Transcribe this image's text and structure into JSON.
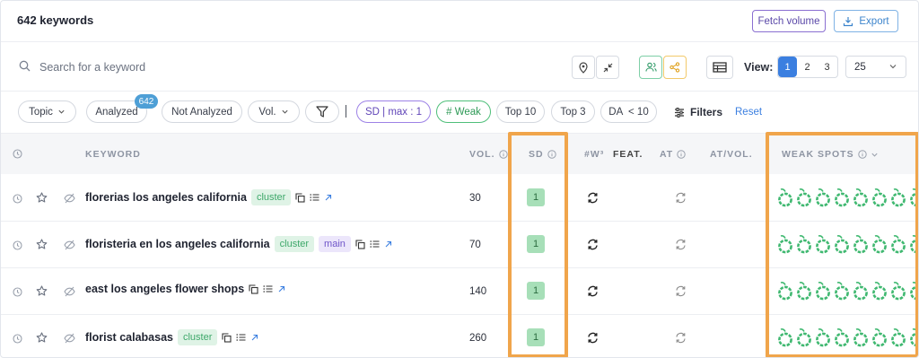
{
  "header": {
    "title": "642 keywords",
    "fetch_label": "Fetch volume",
    "export_label": "Export"
  },
  "search": {
    "placeholder": "Search for a keyword"
  },
  "view": {
    "label": "View:",
    "pages": [
      "1",
      "2",
      "3"
    ],
    "active_page": "1",
    "per_page": "25"
  },
  "filters": {
    "topic": "Topic",
    "analyzed": "Analyzed",
    "analyzed_count": "642",
    "not_analyzed": "Not Analyzed",
    "vol": "Vol.",
    "sd": "SD | max : 1",
    "weak": "# Weak",
    "top10": "Top 10",
    "top3": "Top 3",
    "da": "DA  < 10",
    "filters": "Filters",
    "reset": "Reset"
  },
  "table": {
    "headers": {
      "keyword": "KEYWORD",
      "vol": "VOL.",
      "sd": "SD",
      "w3": "#W³",
      "feat": "FEAT.",
      "at": "AT",
      "atvol": "AT/VOL.",
      "weak_spots": "WEAK SPOTS"
    },
    "rows": [
      {
        "keyword": "florerias los angeles california",
        "tags": [
          "cluster"
        ],
        "vol": "30",
        "sd": "1"
      },
      {
        "keyword": "floristeria en los angeles california",
        "tags": [
          "cluster",
          "main"
        ],
        "vol": "70",
        "sd": "1"
      },
      {
        "keyword": "east los angeles flower shops",
        "tags": [],
        "vol": "140",
        "sd": "1"
      },
      {
        "keyword": "florist calabasas",
        "tags": [
          "cluster"
        ],
        "vol": "260",
        "sd": "1"
      }
    ]
  },
  "colors": {
    "accent": "#3b7fe0",
    "highlight": "#f0a54b",
    "weak_spot": "#3fb870",
    "sd_badge": "#a7dfb8"
  }
}
